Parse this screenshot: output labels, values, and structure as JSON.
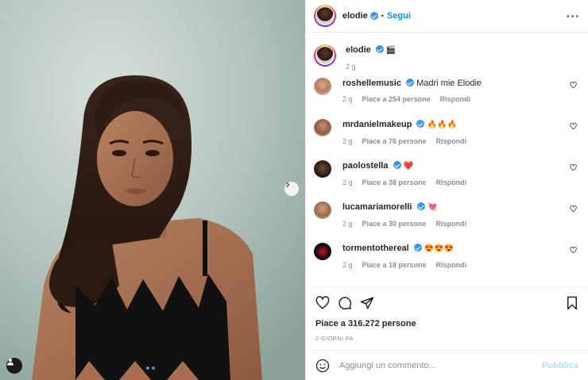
{
  "post": {
    "author": "elodie",
    "follow_label": "Segui",
    "separator": "•",
    "more_label": "···"
  },
  "caption": {
    "username": "elodie",
    "text": "🎬",
    "time": "2 g"
  },
  "comments": [
    {
      "username": "roshellemusic",
      "text": "Madri mie Elodie",
      "time": "2 g",
      "likes": "Piace a 254 persone",
      "reply": "Rispondi"
    },
    {
      "username": "mrdanielmakeup",
      "text": "🔥🔥🔥",
      "time": "2 g",
      "likes": "Piace a 76 persone",
      "reply": "Rispondi"
    },
    {
      "username": "paolostella",
      "text": "❤️",
      "time": "2 g",
      "likes": "Piace a 38 persone",
      "reply": "Rispondi"
    },
    {
      "username": "lucamariamorelli",
      "text": "💘",
      "time": "2 g",
      "likes": "Piace a 30 persone",
      "reply": "Rispondi"
    },
    {
      "username": "tormentothereal",
      "text": "😍😍😍",
      "time": "2 g",
      "likes": "Piace a 18 persone",
      "reply": "Rispondi"
    }
  ],
  "likes_total": "Piace a 316.272 persone",
  "date_label": "2 GIORNI FA",
  "comment_box": {
    "placeholder": "Aggiungi un commento...",
    "publish_label": "Pubblica"
  },
  "colors": {
    "accent": "#0095f6",
    "verified": "#3897f0",
    "muted": "#8e8e8e"
  },
  "carousel": {
    "current": 1,
    "total": 2
  }
}
